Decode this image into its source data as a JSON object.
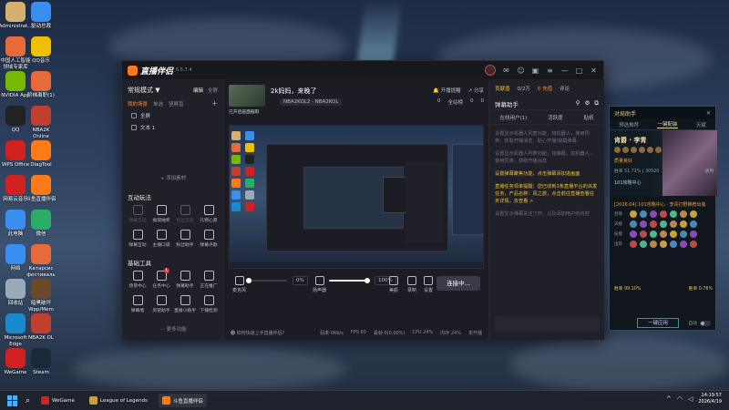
{
  "desktop": {
    "icons": [
      {
        "label": "Administrat...",
        "color": "#d6b070"
      },
      {
        "label": "驱动总裁",
        "color": "#3a8ef0"
      },
      {
        "label": "中国人工智能\n领域专家库",
        "color": "#e86a3a"
      },
      {
        "label": "QQ音乐",
        "color": "#f0c000"
      },
      {
        "label": "NVIDIA App",
        "color": "#76b900"
      },
      {
        "label": "阶梯离职(1)",
        "color": "#e86a3a"
      },
      {
        "label": "QQ",
        "color": "#222"
      },
      {
        "label": "NBA2K\nOnline",
        "color": "#c04030"
      },
      {
        "label": "WPS Office",
        "color": "#d02020"
      },
      {
        "label": "DiagTool",
        "color": "#ff7a18"
      },
      {
        "label": "网易云音乐",
        "color": "#d02020"
      },
      {
        "label": "斗鱼直播伴侣",
        "color": "#ff7a18"
      },
      {
        "label": "此电脑",
        "color": "#3a8ef0"
      },
      {
        "label": "微信",
        "color": "#2aae67"
      },
      {
        "label": "网络",
        "color": "#3a8ef0"
      },
      {
        "label": "Катарсис\nфестиваль",
        "color": "#e86a3a"
      },
      {
        "label": "回收站",
        "color": "#9ab"
      },
      {
        "label": "暗黑破坏\nWpp/Mem",
        "color": "#6a4a2a"
      },
      {
        "label": "Microsoft\nEdge",
        "color": "#1a8ad0"
      },
      {
        "label": "NBA2K OL",
        "color": "#c04030"
      },
      {
        "label": "WeGame",
        "color": "#d02020"
      },
      {
        "label": "Steam",
        "color": "#1b2838"
      }
    ]
  },
  "app": {
    "name": "直播伴侣",
    "version": "6.5.7.4",
    "sidebar": {
      "mode_label": "常规模式 ▼",
      "edit_tab": "编辑",
      "full_tab": "全屏",
      "scene_title": "我的场景",
      "scene_tab_1": "单选",
      "scene_tab_2": "竖屏直",
      "scene_tab_3": "竖屏直",
      "sources": [
        "全屏",
        "文本 1"
      ],
      "add_material": "+ 添加素材",
      "interactive_title": "互动玩法",
      "interactive_tools": [
        {
          "label": "弹幕互动",
          "dim": true
        },
        {
          "label": "福袋抽奖",
          "dim": false
        },
        {
          "label": "粉丝互动",
          "dim": true
        },
        {
          "label": "礼物心愿",
          "dim": false
        },
        {
          "label": "弹幕互动",
          "dim": false
        },
        {
          "label": "主播口袋",
          "dim": false
        },
        {
          "label": "粉丝助手",
          "dim": false
        },
        {
          "label": "弹幕点歌",
          "dim": false
        }
      ],
      "basic_title": "基础工具",
      "basic_tools": [
        {
          "label": "场景中心",
          "badge": ""
        },
        {
          "label": "任务中心",
          "badge": "1"
        },
        {
          "label": "弹幕助手",
          "badge": ""
        },
        {
          "label": "正在推广",
          "badge": ""
        },
        {
          "label": "弹幕墙",
          "badge": ""
        },
        {
          "label": "房管助手",
          "badge": ""
        },
        {
          "label": "直播小助手",
          "badge": ""
        },
        {
          "label": "下播检测",
          "badge": ""
        }
      ],
      "more": "⋯ 更多功能"
    },
    "stream": {
      "thumb_caption": "已开启画面截取",
      "title": "2k妈妈，来晚了",
      "category": "NBA2KOL2 · NBA2KOL",
      "actions": [
        "开播提醒",
        "分享"
      ],
      "stats": [
        "0",
        "全站榜",
        "0",
        "0"
      ]
    },
    "controls": {
      "mic_label": "麦克风",
      "mic_pct": "0%",
      "speaker_label": "扬声器",
      "speaker_pct": "100%",
      "mic_level": 0.05,
      "speaker_level": 0.95,
      "beauty": "美颜",
      "record": "录制",
      "settings": "设置",
      "go_live": "连接中..."
    },
    "status": {
      "tip": "⓿ 如何快速上手直播伴侣?",
      "stats": [
        "码率 0Kb/s",
        "FPS 60",
        "丢帧 0(0.00%)",
        "CPU 24%",
        "内存 24%",
        "未开播"
      ]
    },
    "rpanel": {
      "top_items": [
        "贡献值",
        "0/2万",
        "0 充值",
        "评论"
      ],
      "danmu_title": "弹幕助手",
      "tabs": [
        "在线用户(1)",
        "活跃度",
        "贴纸"
      ],
      "msgs": [
        "设置显示机器人列表功能，如机器人，使用同类，获取开播消息，贴心开播/提醒弹幕",
        "设置显示机器人列表功能，如弹幕，如机器人，使用同类，获取开播消息",
        "设置弹幕聚焦功能，点击弹幕添加进画面",
        "直播任务领单提醒：您已收到1条直播平台的派发任务，产品名称：风之旅，点击前往直播查看任务详情。去查看 >",
        "设置显示弹幕关注了你，以及添加用户的内容"
      ],
      "btn_view": "去查看 >"
    }
  },
  "lol": {
    "title": "对局助手",
    "tabs": [
      "预选推荐",
      "一键配装",
      "天赋"
    ],
    "hero_name": "肯爵 · 李青",
    "hero_tag": "质量良好",
    "hero_stats": "胜率 51.72% | 30920",
    "hero_op": "使用",
    "hero_sub": "101攻略中心",
    "version": "[2026.04] 101攻略中心 · 李青打野推荐出装",
    "row_labels": [
      "召唤",
      "天赋",
      "技能",
      "出装"
    ],
    "rate_left": "胜率 99.10%",
    "rate_right": "胜率 0.76%",
    "apply_btn": "一键应用",
    "auto_label": "自动"
  },
  "taskbar": {
    "apps": [
      "WeGame",
      "League of Legends",
      "斗鱼直播伴侣"
    ],
    "time": "14:19:57",
    "date": "2026/4/19"
  }
}
